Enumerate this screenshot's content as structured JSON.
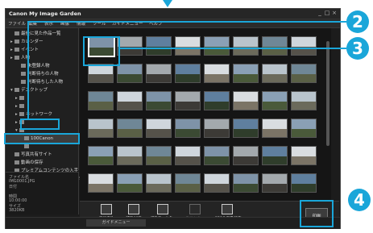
{
  "colors": {
    "callout": "#1aa6d9",
    "window_bg": "#1c1c1c"
  },
  "window": {
    "title": "Canon My Image Garden",
    "controls": [
      "_",
      "□",
      "×"
    ]
  },
  "menu": [
    "ファイル",
    "編集",
    "表示",
    "画像",
    "情報",
    "ツール",
    "ガイドメニュー",
    "ヘルプ"
  ],
  "sidebar": {
    "items": [
      {
        "label": "最後に見た作品一覧",
        "icon": "clock-icon",
        "glyph": ""
      },
      {
        "label": "カレンダー",
        "icon": "calendar-icon",
        "glyph": "▸"
      },
      {
        "label": "イベント",
        "icon": "event-icon",
        "glyph": "▸"
      },
      {
        "label": "人物",
        "icon": "person-icon",
        "glyph": "▸"
      },
      {
        "label": "未登録人物",
        "icon": "person-icon",
        "glyph": ""
      },
      {
        "label": "判断待ちの人物",
        "icon": "person-icon",
        "glyph": ""
      },
      {
        "label": "判断待ちした人物",
        "icon": "person-icon",
        "glyph": ""
      },
      {
        "label": "デスクトップ",
        "icon": "folder-icon",
        "glyph": "▾"
      },
      {
        "label": "",
        "icon": "folder-icon",
        "glyph": "▸"
      },
      {
        "label": "",
        "icon": "folder-icon",
        "glyph": "▸"
      },
      {
        "label": "ネットワーク",
        "icon": "network-icon",
        "glyph": "▸"
      },
      {
        "label": "",
        "icon": "folder-icon",
        "glyph": "▸"
      },
      {
        "label": "",
        "icon": "folder-icon",
        "glyph": "▾"
      },
      {
        "label": "100Canon",
        "icon": "folder-icon",
        "glyph": "",
        "selected": true
      },
      {
        "label": "",
        "icon": "folder-icon",
        "glyph": ""
      },
      {
        "label": "写真共有サイト",
        "icon": "share-icon",
        "glyph": ""
      },
      {
        "label": "動画の保存",
        "icon": "video-icon",
        "glyph": ""
      },
      {
        "label": "プレミアムコンテンツの入手",
        "icon": "download-icon",
        "glyph": ""
      },
      {
        "label": "入手したプレミアムコンテンツ",
        "icon": "content-icon",
        "glyph": ""
      }
    ]
  },
  "info": {
    "lines": [
      "ファイル名",
      "IMG0001.JPG",
      "日付",
      "",
      "時間",
      "10:00:00",
      "サイズ",
      "3820KB",
      "お気に入り度",
      ""
    ]
  },
  "toolbar": {
    "tools": [
      {
        "label": "新規作品",
        "icon": "new-item-icon",
        "enabled": true
      },
      {
        "label": "補正/加工",
        "icon": "edit-icon",
        "enabled": true
      },
      {
        "label": "特殊フィルター",
        "icon": "filter-icon",
        "enabled": true
      },
      {
        "label": "動画から...",
        "icon": "video-capture-icon",
        "enabled": false
      },
      {
        "label": "PDFの作成/編集",
        "icon": "pdf-icon",
        "enabled": true
      }
    ],
    "print_label": "印刷"
  },
  "status": {
    "guide_tab": "ガイドメニュー"
  },
  "callouts": [
    "2",
    "3",
    "4"
  ]
}
